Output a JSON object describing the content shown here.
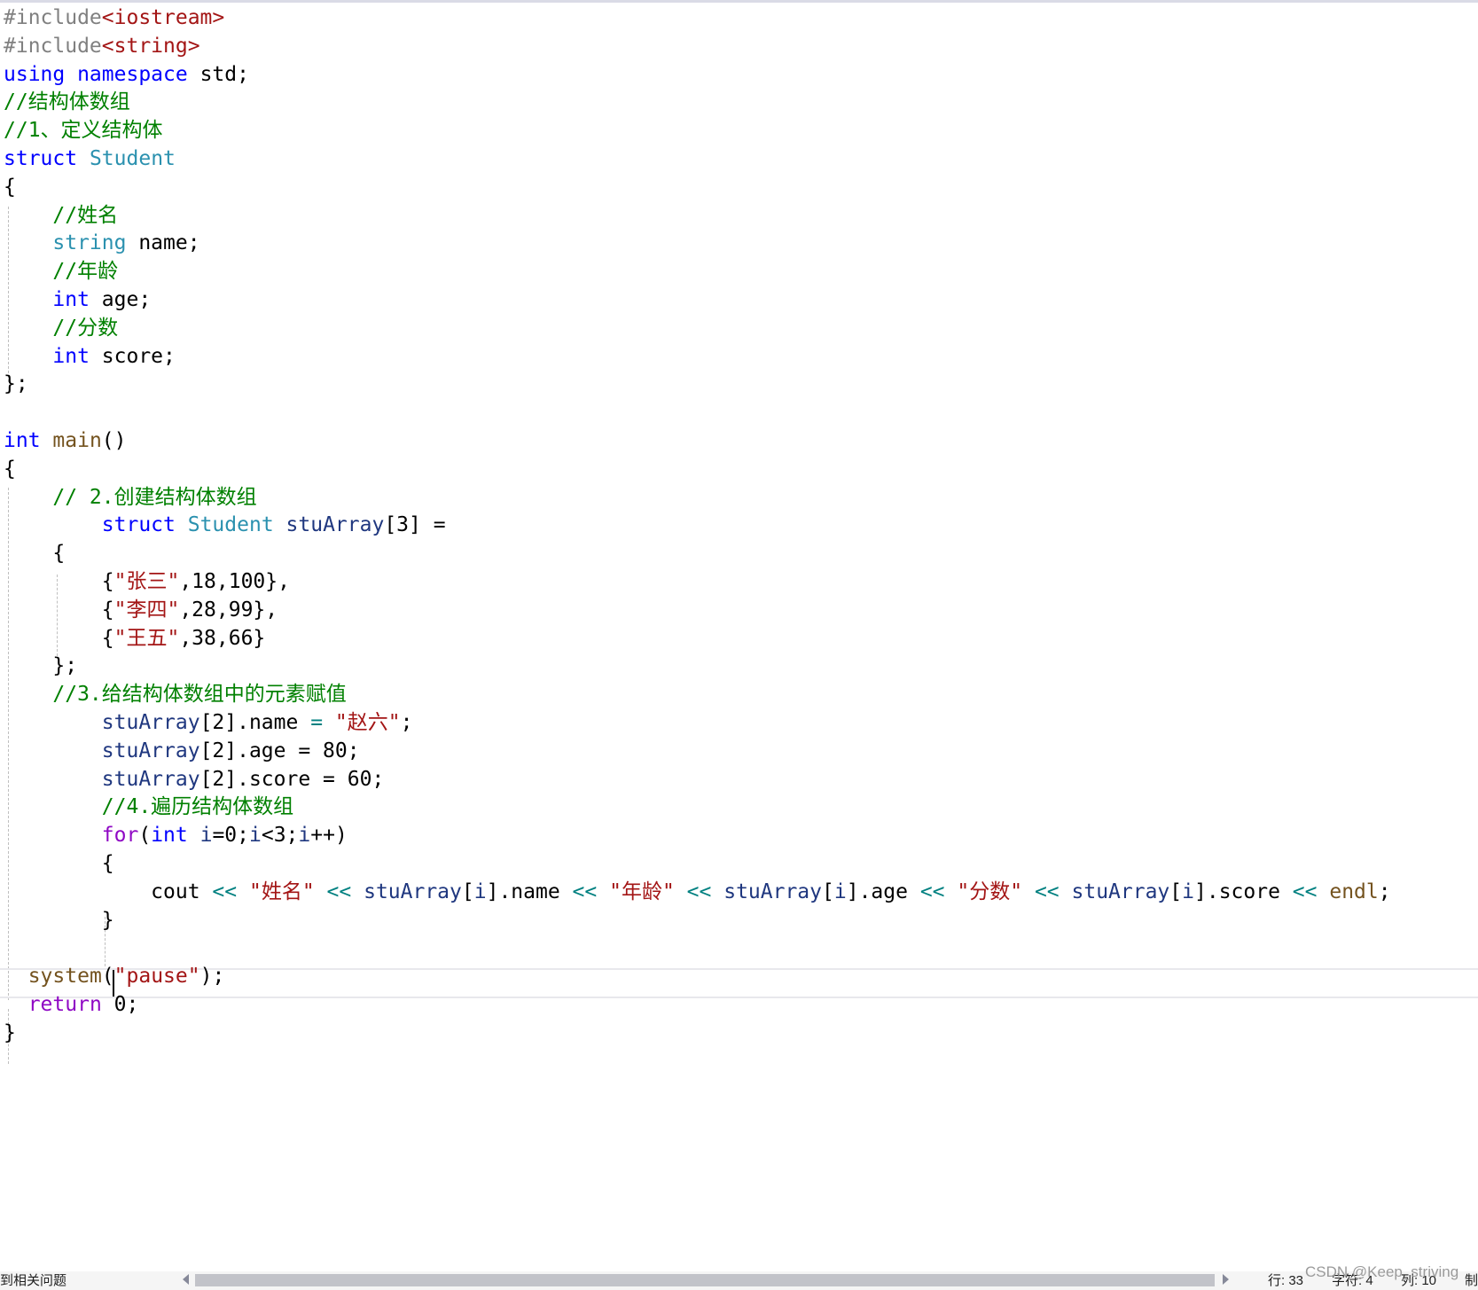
{
  "editor": {
    "language": "cpp",
    "lines": [
      [
        {
          "t": "#include",
          "c": "preproc"
        },
        {
          "t": "<iostream>",
          "c": "string"
        }
      ],
      [
        {
          "t": "#include",
          "c": "preproc"
        },
        {
          "t": "<string>",
          "c": "string"
        }
      ],
      [
        {
          "t": "using namespace",
          "c": "keyword"
        },
        {
          "t": " std;",
          "c": "plain"
        }
      ],
      [
        {
          "t": "//结构体数组",
          "c": "comment"
        }
      ],
      [
        {
          "t": "//1、定义结构体",
          "c": "comment"
        }
      ],
      [
        {
          "t": "struct",
          "c": "keyword"
        },
        {
          "t": " ",
          "c": "plain"
        },
        {
          "t": "Student",
          "c": "type"
        }
      ],
      [
        {
          "t": "{",
          "c": "brace"
        }
      ],
      [
        {
          "t": "    ",
          "c": "plain"
        },
        {
          "t": "//姓名",
          "c": "comment"
        }
      ],
      [
        {
          "t": "    ",
          "c": "plain"
        },
        {
          "t": "string",
          "c": "type"
        },
        {
          "t": " name;",
          "c": "plain"
        }
      ],
      [
        {
          "t": "    ",
          "c": "plain"
        },
        {
          "t": "//年龄",
          "c": "comment"
        }
      ],
      [
        {
          "t": "    ",
          "c": "plain"
        },
        {
          "t": "int",
          "c": "keyword"
        },
        {
          "t": " age;",
          "c": "plain"
        }
      ],
      [
        {
          "t": "    ",
          "c": "plain"
        },
        {
          "t": "//分数",
          "c": "comment"
        }
      ],
      [
        {
          "t": "    ",
          "c": "plain"
        },
        {
          "t": "int",
          "c": "keyword"
        },
        {
          "t": " score;",
          "c": "plain"
        }
      ],
      [
        {
          "t": "};",
          "c": "plain"
        }
      ],
      [],
      [
        {
          "t": "int",
          "c": "keyword"
        },
        {
          "t": " ",
          "c": "plain"
        },
        {
          "t": "main",
          "c": "func"
        },
        {
          "t": "()",
          "c": "plain"
        }
      ],
      [
        {
          "t": "{",
          "c": "brace"
        }
      ],
      [
        {
          "t": "    ",
          "c": "plain"
        },
        {
          "t": "// 2.创建结构体数组",
          "c": "comment"
        }
      ],
      [
        {
          "t": "        ",
          "c": "plain"
        },
        {
          "t": "struct",
          "c": "keyword"
        },
        {
          "t": " ",
          "c": "plain"
        },
        {
          "t": "Student",
          "c": "type"
        },
        {
          "t": " ",
          "c": "plain"
        },
        {
          "t": "stuArray",
          "c": "var"
        },
        {
          "t": "[3] =",
          "c": "plain"
        }
      ],
      [
        {
          "t": "    {",
          "c": "plain"
        }
      ],
      [
        {
          "t": "        {",
          "c": "plain"
        },
        {
          "t": "\"张三\"",
          "c": "string"
        },
        {
          "t": ",18,100},",
          "c": "plain"
        }
      ],
      [
        {
          "t": "        {",
          "c": "plain"
        },
        {
          "t": "\"李四\"",
          "c": "string"
        },
        {
          "t": ",28,99},",
          "c": "plain"
        }
      ],
      [
        {
          "t": "        {",
          "c": "plain"
        },
        {
          "t": "\"王五\"",
          "c": "string"
        },
        {
          "t": ",38,66}",
          "c": "plain"
        }
      ],
      [
        {
          "t": "    };",
          "c": "plain"
        }
      ],
      [
        {
          "t": "    ",
          "c": "plain"
        },
        {
          "t": "//3.给结构体数组中的元素赋值",
          "c": "comment"
        }
      ],
      [
        {
          "t": "        ",
          "c": "plain"
        },
        {
          "t": "stuArray",
          "c": "var"
        },
        {
          "t": "[2].name ",
          "c": "plain"
        },
        {
          "t": "=",
          "c": "op"
        },
        {
          "t": " ",
          "c": "plain"
        },
        {
          "t": "\"赵六\"",
          "c": "string"
        },
        {
          "t": ";",
          "c": "plain"
        }
      ],
      [
        {
          "t": "        ",
          "c": "plain"
        },
        {
          "t": "stuArray",
          "c": "var"
        },
        {
          "t": "[2].age = 80;",
          "c": "plain"
        }
      ],
      [
        {
          "t": "        ",
          "c": "plain"
        },
        {
          "t": "stuArray",
          "c": "var"
        },
        {
          "t": "[2].score = 60;",
          "c": "plain"
        }
      ],
      [
        {
          "t": "        ",
          "c": "plain"
        },
        {
          "t": "//4.遍历结构体数组",
          "c": "comment"
        }
      ],
      [
        {
          "t": "        ",
          "c": "plain"
        },
        {
          "t": "for",
          "c": "flow"
        },
        {
          "t": "(",
          "c": "plain"
        },
        {
          "t": "int",
          "c": "keyword"
        },
        {
          "t": " ",
          "c": "plain"
        },
        {
          "t": "i",
          "c": "var"
        },
        {
          "t": "=0;",
          "c": "plain"
        },
        {
          "t": "i",
          "c": "var"
        },
        {
          "t": "<3;",
          "c": "plain"
        },
        {
          "t": "i",
          "c": "var"
        },
        {
          "t": "++)",
          "c": "plain"
        }
      ],
      [
        {
          "t": "        {",
          "c": "plain"
        }
      ],
      [
        {
          "t": "            cout ",
          "c": "plain"
        },
        {
          "t": "<<",
          "c": "op"
        },
        {
          "t": " ",
          "c": "plain"
        },
        {
          "t": "\"姓名\"",
          "c": "string"
        },
        {
          "t": " ",
          "c": "plain"
        },
        {
          "t": "<<",
          "c": "op"
        },
        {
          "t": " ",
          "c": "plain"
        },
        {
          "t": "stuArray",
          "c": "var"
        },
        {
          "t": "[",
          "c": "plain"
        },
        {
          "t": "i",
          "c": "var"
        },
        {
          "t": "].name ",
          "c": "plain"
        },
        {
          "t": "<<",
          "c": "op"
        },
        {
          "t": " ",
          "c": "plain"
        },
        {
          "t": "\"年龄\"",
          "c": "string"
        },
        {
          "t": " ",
          "c": "plain"
        },
        {
          "t": "<<",
          "c": "op"
        },
        {
          "t": " ",
          "c": "plain"
        },
        {
          "t": "stuArray",
          "c": "var"
        },
        {
          "t": "[",
          "c": "plain"
        },
        {
          "t": "i",
          "c": "var"
        },
        {
          "t": "].age ",
          "c": "plain"
        },
        {
          "t": "<<",
          "c": "op"
        },
        {
          "t": " ",
          "c": "plain"
        },
        {
          "t": "\"分数\"",
          "c": "string"
        },
        {
          "t": " ",
          "c": "plain"
        },
        {
          "t": "<<",
          "c": "op"
        },
        {
          "t": " ",
          "c": "plain"
        },
        {
          "t": "stuArray",
          "c": "var"
        },
        {
          "t": "[",
          "c": "plain"
        },
        {
          "t": "i",
          "c": "var"
        },
        {
          "t": "].score ",
          "c": "plain"
        },
        {
          "t": "<<",
          "c": "op"
        },
        {
          "t": " ",
          "c": "plain"
        },
        {
          "t": "endl",
          "c": "func"
        },
        {
          "t": ";",
          "c": "plain"
        }
      ],
      [
        {
          "t": "        }",
          "c": "plain"
        }
      ],
      [],
      [
        {
          "t": "  ",
          "c": "plain"
        },
        {
          "t": "system",
          "c": "func"
        },
        {
          "t": "(",
          "c": "plain"
        },
        {
          "t": "\"pause\"",
          "c": "string"
        },
        {
          "t": ");",
          "c": "plain"
        }
      ],
      [
        {
          "t": "  ",
          "c": "plain"
        },
        {
          "t": "return",
          "c": "flow"
        },
        {
          "t": " 0;",
          "c": "plain"
        }
      ],
      [
        {
          "t": "}",
          "c": "plain"
        }
      ]
    ]
  },
  "status_bar": {
    "problems_text": "到相关问题",
    "line_label": "行: 33",
    "char_label": "字符: 4",
    "col_label": "列: 10",
    "extra": "制"
  },
  "watermark": "CSDN @Keep_striving",
  "colors": {
    "preproc": "#808080",
    "keyword": "#0000ff",
    "type": "#2b91af",
    "comment": "#008000",
    "string": "#a31515",
    "func": "#74531f",
    "var": "#1f377f",
    "flow": "#8f08c4",
    "operator": "#008080"
  }
}
